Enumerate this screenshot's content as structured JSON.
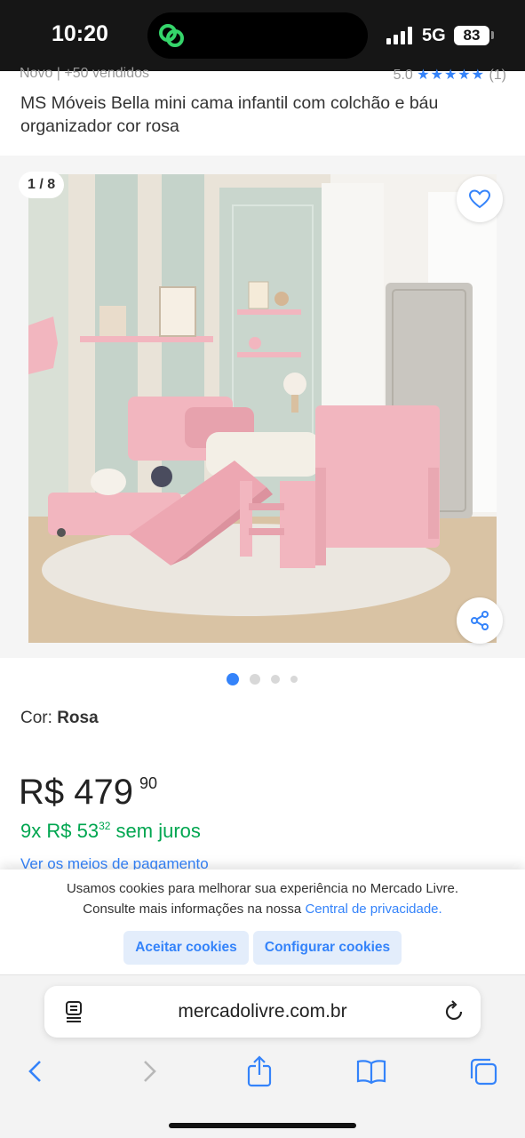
{
  "status_bar": {
    "time": "10:20",
    "network": "5G",
    "battery": "83"
  },
  "product": {
    "meta_left": "Novo  |  +50 vendidos",
    "rating": "5.0",
    "stars": "★★★★★",
    "reviews": "(1)",
    "title": "MS Móveis Bella mini cama infantil com colchão e báu organizador cor rosa"
  },
  "gallery": {
    "counter": "1 / 8",
    "slide_count": 4,
    "active_slide": 1,
    "icons": {
      "favorite": "heart-icon",
      "share": "share-icon"
    }
  },
  "variation": {
    "label": "Cor:",
    "value": "Rosa"
  },
  "price": {
    "currency": "R$",
    "whole": "479",
    "cents": "90",
    "installments_prefix": "9x R$ 53",
    "installments_cents": "32",
    "installments_suffix": "sem juros",
    "payment_link": "Ver os meios de pagamento"
  },
  "cookies": {
    "text_line1": "Usamos cookies para melhorar sua experiência no Mercado Livre.",
    "text_line2": "Consulte mais informações na nossa",
    "privacy_link": "Central de privacidade.",
    "accept_label": "Aceitar cookies",
    "configure_label": "Configurar cookies"
  },
  "browser": {
    "url": "mercadolivre.com.br",
    "icons": [
      "tabs-icon",
      "reload-icon",
      "back-icon",
      "forward-icon",
      "share-icon",
      "bookmarks-icon",
      "tab-overview-icon"
    ]
  },
  "colors": {
    "accent": "#3483fa",
    "price_green": "#00a650",
    "bed_pink": "#f2b6bf",
    "status_bar": "#161616"
  }
}
